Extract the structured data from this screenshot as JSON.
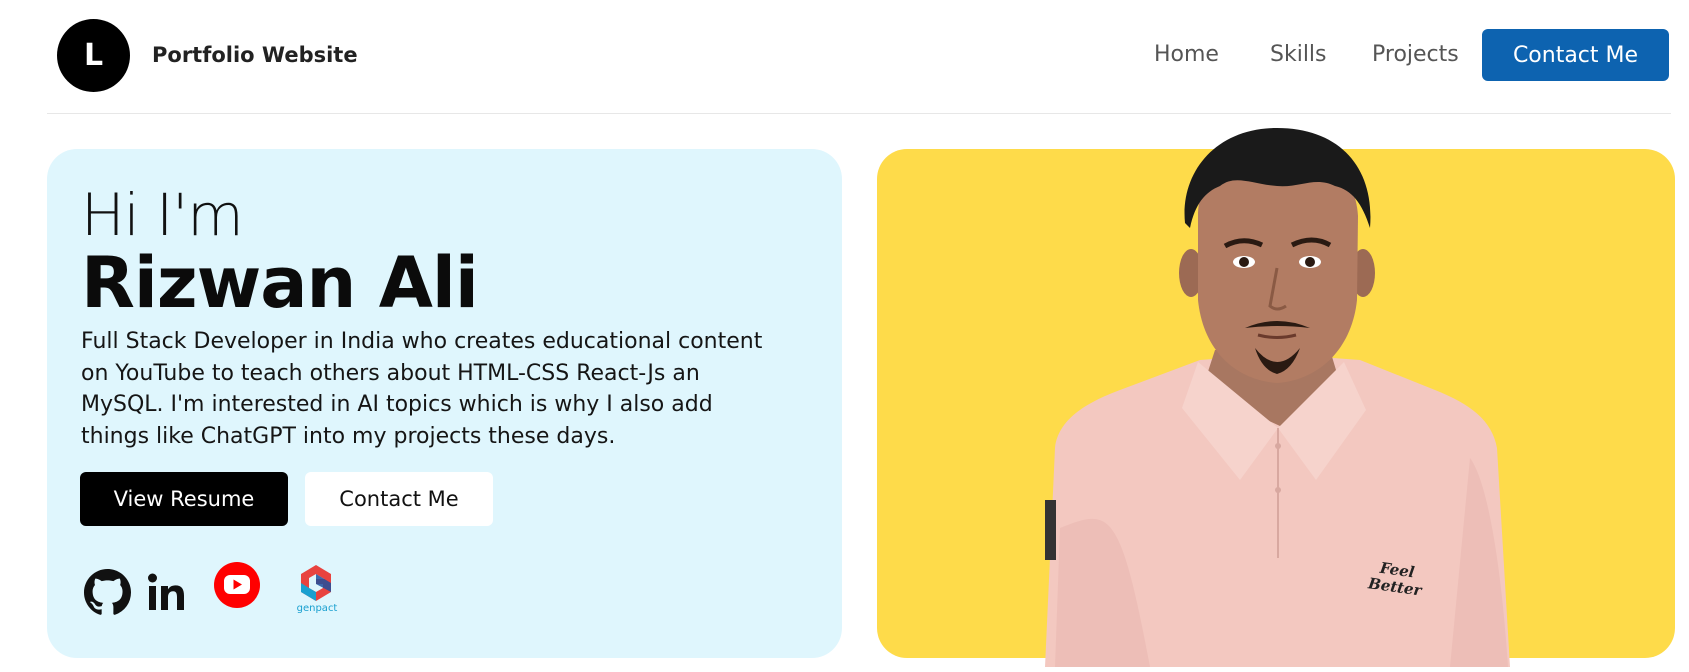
{
  "header": {
    "logo_letter": "L",
    "site_title": "Portfolio Website",
    "nav": [
      "Home",
      "Skills",
      "Projects"
    ],
    "cta": "Contact Me"
  },
  "hero": {
    "greeting": "Hi I'm",
    "name": "Rizwan Ali",
    "bio": "Full Stack Developer in India who creates educational content on YouTube to teach others about HTML-CSS React-Js an MySQL. I'm interested in AI topics which is why I also add things like ChatGPT into my projects these days.",
    "primary_button": "View Resume",
    "secondary_button": "Contact Me",
    "social_icons": [
      "github-icon",
      "linkedin-icon",
      "youtube-icon",
      "genpact-icon"
    ],
    "genpact_label": "genpact"
  },
  "portrait": {
    "shirt_text": "Feel Better"
  },
  "colors": {
    "accent_blue": "#0d63b0",
    "hero_bg": "#dff6fd",
    "photo_bg": "#fedb4a",
    "youtube_red": "#ff0000"
  }
}
